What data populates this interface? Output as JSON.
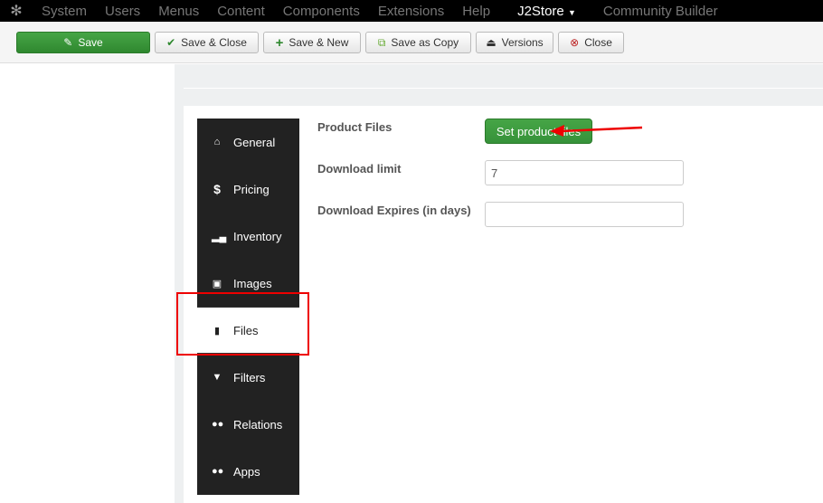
{
  "topnav": {
    "items": [
      "System",
      "Users",
      "Menus",
      "Content",
      "Components",
      "Extensions",
      "Help"
    ],
    "active": "J2Store",
    "after": "Community Builder"
  },
  "toolbar": {
    "save": "Save",
    "save_close": "Save & Close",
    "save_new": "Save & New",
    "save_copy": "Save as Copy",
    "versions": "Versions",
    "close": "Close"
  },
  "tabs": [
    {
      "label": "General",
      "icon": "home-icon"
    },
    {
      "label": "Pricing",
      "icon": "dollar-icon"
    },
    {
      "label": "Inventory",
      "icon": "signal-icon"
    },
    {
      "label": "Images",
      "icon": "image-icon"
    },
    {
      "label": "Files",
      "icon": "file-icon",
      "active": true
    },
    {
      "label": "Filters",
      "icon": "filter-icon"
    },
    {
      "label": "Relations",
      "icon": "users-icon"
    },
    {
      "label": "Apps",
      "icon": "users-icon"
    }
  ],
  "form": {
    "product_files_label": "Product Files",
    "set_files_button": "Set product files",
    "download_limit_label": "Download limit",
    "download_limit_value": "7",
    "download_expires_label": "Download Expires (in days)",
    "download_expires_value": ""
  },
  "colors": {
    "annotation": "#e00000",
    "green": "#3d9a3d"
  }
}
